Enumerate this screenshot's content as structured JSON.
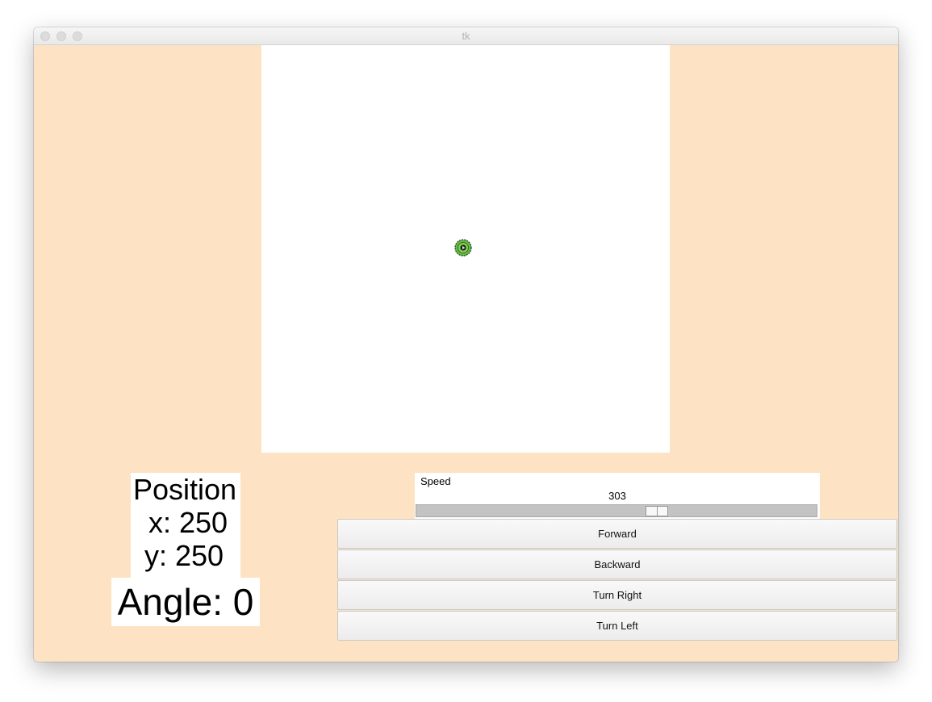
{
  "window": {
    "title": "tk",
    "background_color": "#fde3c4"
  },
  "canvas": {
    "background_color": "#ffffff",
    "robot_color": "#66bb44"
  },
  "readout": {
    "position_heading": "Position",
    "x_text": "x: 250",
    "y_text": "y: 250",
    "angle_text": "Angle: 0"
  },
  "speed": {
    "label": "Speed",
    "value": "303",
    "level_fraction": 0.6
  },
  "buttons": {
    "forward": "Forward",
    "backward": "Backward",
    "turn_right": "Turn Right",
    "turn_left": "Turn Left"
  }
}
